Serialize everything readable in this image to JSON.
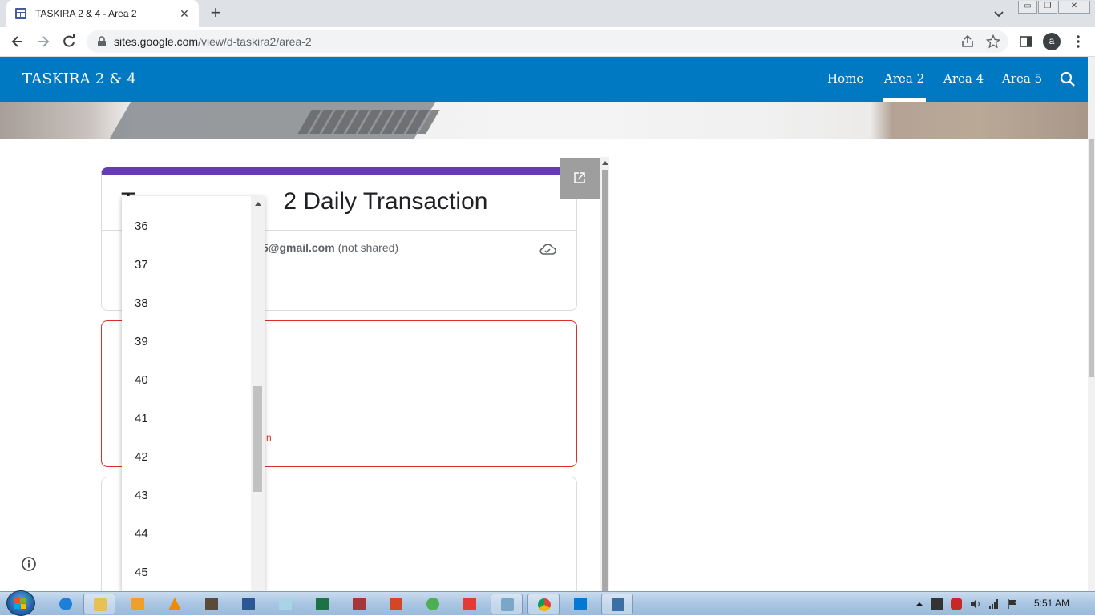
{
  "browser": {
    "tab_title": "TASKIRA 2 & 4 - Area 2",
    "url_host": "sites.google.com",
    "url_path": "/view/d-taskira2/area-2",
    "avatar_letter": "a"
  },
  "site": {
    "title": "TASKIRA 2 & 4",
    "nav": [
      "Home",
      "Area 2",
      "Area 4",
      "Area 5"
    ],
    "active_nav": "Area 2",
    "header_color": "#0078c2"
  },
  "form": {
    "title": "Taskira Area 2 Daily Transaction",
    "title_visible_left": "T",
    "title_visible_right": "2 Daily Transaction",
    "account_suffix": "5@gmail.com",
    "not_shared": "(not shared)",
    "error_fragment": "n",
    "accent_color": "#673ab7",
    "error_color": "#d93025"
  },
  "dropdown": {
    "options": [
      "36",
      "37",
      "38",
      "39",
      "40",
      "41",
      "42",
      "43",
      "44",
      "45"
    ]
  },
  "taskbar": {
    "clock": "5:51 AM"
  }
}
